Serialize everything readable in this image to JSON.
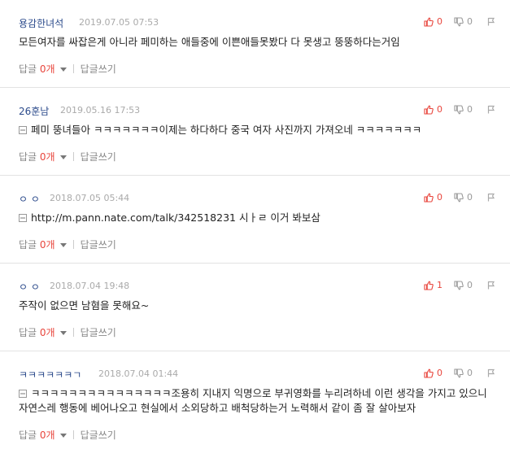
{
  "comments": [
    {
      "author": "용감한녀석",
      "date": "2019.07.05 07:53",
      "up": "0",
      "down": "0",
      "has_image": false,
      "text": "모든여자를 싸잡은게 아니라 페미하는 애들중에 이쁜애들못봤다 다 못생고 뚱뚱하다는거임",
      "reply_label": "답글",
      "reply_count": "0개",
      "write_label": "답글쓰기"
    },
    {
      "author": "26훈남",
      "date": "2019.05.16 17:53",
      "up": "0",
      "down": "0",
      "has_image": true,
      "text": "페미 뚱녀들아 ㅋㅋㅋㅋㅋㅋㅋ이제는 하다하다 중국 여자 사진까지 가져오네 ㅋㅋㅋㅋㅋㅋㅋ",
      "reply_label": "답글",
      "reply_count": "0개",
      "write_label": "답글쓰기"
    },
    {
      "author": "ㅇ ㅇ",
      "date": "2018.07.05 05:44",
      "up": "0",
      "down": "0",
      "has_image": true,
      "text": "http://m.pann.nate.com/talk/342518231 시ㅏㄹ 이거 봐보삼",
      "reply_label": "답글",
      "reply_count": "0개",
      "write_label": "답글쓰기"
    },
    {
      "author": "ㅇ ㅇ",
      "date": "2018.07.04 19:48",
      "up": "1",
      "down": "0",
      "has_image": false,
      "text": "주작이 없으면 남혐을 못해요~",
      "reply_label": "답글",
      "reply_count": "0개",
      "write_label": "답글쓰기"
    },
    {
      "author": "ㅋㅋㅋㅋㅋㅋㄱ",
      "date": "2018.07.04 01:44",
      "up": "0",
      "down": "0",
      "has_image": true,
      "text": "ㅋㅋㅋㅋㅋㅋㅋㅋㅋㅋㅋㅋㅋㅋㅋ조용히 지내지 익명으로 부귀영화를 누리려하네 이런 생각을 가지고 있으니 자연스레 행동에 베어나오고 현실에서 소외당하고 배척당하는거 노력해서 같이 좀 잘 살아보자",
      "reply_label": "답글",
      "reply_count": "0개",
      "write_label": "답글쓰기"
    }
  ],
  "icons": {
    "thumb_up": "thumb-up-icon",
    "thumb_down": "thumb-down-icon",
    "report": "report-flag-icon",
    "image": "image-icon"
  },
  "colors": {
    "author": "#2b4a8b",
    "up_count": "#e8453c",
    "reply_zero": "#e8453c",
    "divider": "#e3e3e3"
  }
}
